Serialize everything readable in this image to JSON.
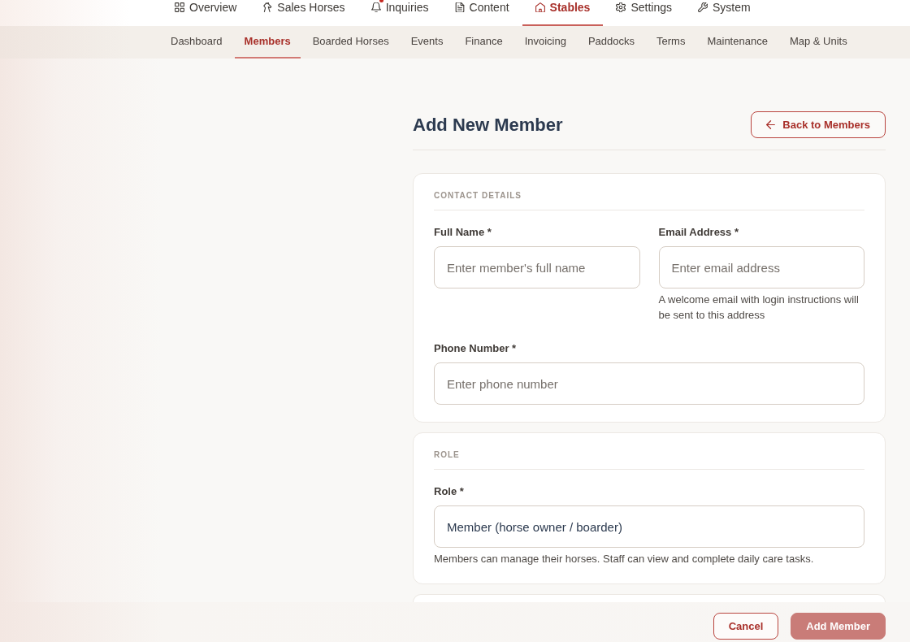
{
  "top_nav": [
    {
      "label": "Overview",
      "selected": false,
      "unread": false
    },
    {
      "label": "Sales Horses",
      "selected": false,
      "unread": false
    },
    {
      "label": "Inquiries",
      "selected": false,
      "unread": true
    },
    {
      "label": "Content",
      "selected": false,
      "unread": false
    },
    {
      "label": "Stables",
      "selected": true,
      "unread": false
    },
    {
      "label": "Settings",
      "selected": false,
      "unread": false
    },
    {
      "label": "System",
      "selected": false,
      "unread": false
    }
  ],
  "sub_nav": [
    {
      "label": "Dashboard",
      "selected": false
    },
    {
      "label": "Members",
      "selected": true
    },
    {
      "label": "Boarded Horses",
      "selected": false
    },
    {
      "label": "Events",
      "selected": false
    },
    {
      "label": "Finance",
      "selected": false
    },
    {
      "label": "Invoicing",
      "selected": false
    },
    {
      "label": "Paddocks",
      "selected": false
    },
    {
      "label": "Terms",
      "selected": false
    },
    {
      "label": "Maintenance",
      "selected": false
    },
    {
      "label": "Map & Units",
      "selected": false
    }
  ],
  "page": {
    "title": "Add New Member",
    "back_button": "Back to Members"
  },
  "sections": [
    {
      "title": "CONTACT DETAILS",
      "fields": [
        {
          "kind": "input",
          "label": "Full Name *",
          "placeholder": "Enter member's full name"
        },
        {
          "kind": "input",
          "label": "Email Address *",
          "placeholder": "Enter email address",
          "help": "A welcome email with login instructions will be sent to this address"
        },
        {
          "kind": "input",
          "label": "Phone Number *",
          "placeholder": "Enter phone number"
        }
      ]
    },
    {
      "title": "ROLE",
      "fields": [
        {
          "kind": "select",
          "label": "Role *",
          "value": "Member (horse owner / boarder)",
          "help": "Members can manage their horses. Staff can view and complete daily care tasks."
        }
      ]
    }
  ],
  "actions": [
    {
      "kind": "secondary",
      "label": "Cancel",
      "disabled": false
    },
    {
      "kind": "primary",
      "label": "Add Member",
      "disabled": true
    }
  ]
}
